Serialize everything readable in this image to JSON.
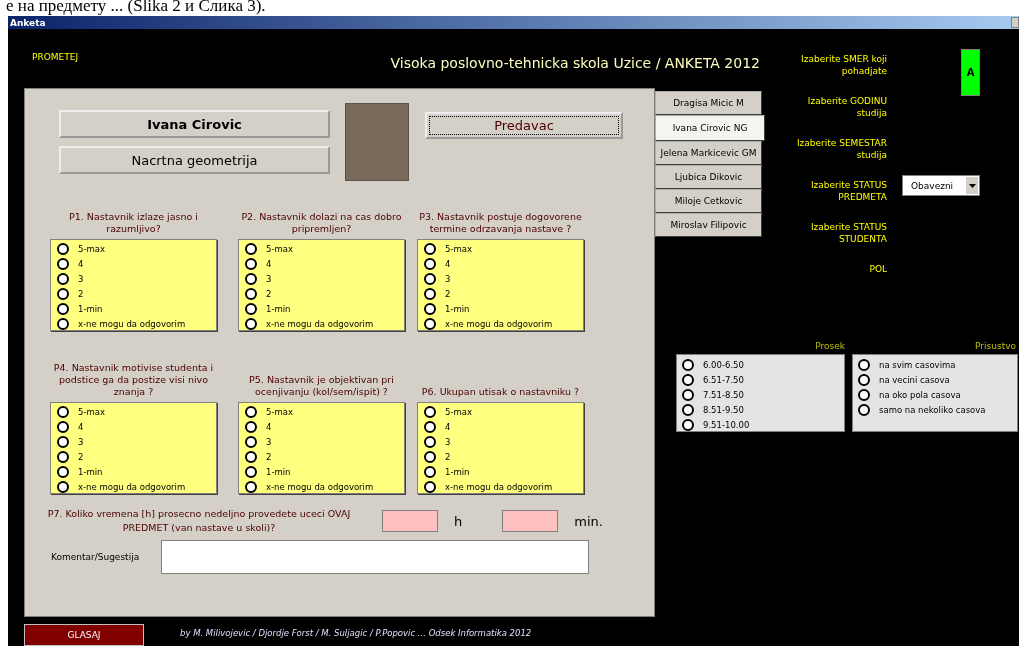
{
  "document_text": "е на предмету ... (Slika 2 и Слика 3).",
  "window": {
    "title": "Anketa"
  },
  "header": {
    "brand": "PROMETEJ",
    "title": "Visoka poslovno-tehnicka skola Uzice / ANKETA 2012"
  },
  "teacher": {
    "name": "Ivana Cirovic",
    "subject": "Nacrtna geometrija",
    "role_button": "Predavac"
  },
  "tabs": [
    {
      "label": "Dragisa Micic M",
      "selected": false
    },
    {
      "label": "Ivana Cirovic NG",
      "selected": true
    },
    {
      "label": "Jelena Markicevic GM",
      "selected": false
    },
    {
      "label": "Ljubica Dikovic",
      "selected": false
    },
    {
      "label": "Miloje Cetkovic",
      "selected": false
    },
    {
      "label": "Miroslav Filipovic",
      "selected": false
    }
  ],
  "questions": [
    {
      "text": "P1. Nastavnik izlaze jasno i razumljivo?",
      "options": [
        {
          "label": "5-max",
          "selected": false
        },
        {
          "label": "4",
          "selected": false
        },
        {
          "label": "3",
          "selected": false
        },
        {
          "label": "2",
          "selected": false
        },
        {
          "label": "1-min",
          "selected": false
        },
        {
          "label": "x-ne mogu da odgovorim",
          "selected": false
        }
      ]
    },
    {
      "text": "P2. Nastavnik dolazi na cas dobro pripremljen?",
      "options": [
        {
          "label": "5-max",
          "selected": false
        },
        {
          "label": "4",
          "selected": false
        },
        {
          "label": "3",
          "selected": false
        },
        {
          "label": "2",
          "selected": false
        },
        {
          "label": "1-min",
          "selected": false
        },
        {
          "label": "x-ne mogu da odgovorim",
          "selected": false
        }
      ]
    },
    {
      "text": "P3. Nastavnik postuje dogovorene termine odrzavanja nastave ?",
      "options": [
        {
          "label": "5-max",
          "selected": false
        },
        {
          "label": "4",
          "selected": false
        },
        {
          "label": "3",
          "selected": false
        },
        {
          "label": "2",
          "selected": false
        },
        {
          "label": "1-min",
          "selected": false
        },
        {
          "label": "x-ne mogu da odgovorim",
          "selected": false
        }
      ]
    },
    {
      "text": "P4. Nastavnik motivise studenta i podstice ga da postize visi nivo znanja ?",
      "options": [
        {
          "label": "5-max",
          "selected": false
        },
        {
          "label": "4",
          "selected": false
        },
        {
          "label": "3",
          "selected": false
        },
        {
          "label": "2",
          "selected": false
        },
        {
          "label": "1-min",
          "selected": false
        },
        {
          "label": "x-ne mogu da odgovorim",
          "selected": false
        }
      ]
    },
    {
      "text": "P5. Nastavnik je objektivan pri ocenjivanju (kol/sem/ispit) ?",
      "options": [
        {
          "label": "5-max",
          "selected": false
        },
        {
          "label": "4",
          "selected": false
        },
        {
          "label": "3",
          "selected": false
        },
        {
          "label": "2",
          "selected": false
        },
        {
          "label": "1-min",
          "selected": false
        },
        {
          "label": "x-ne mogu da odgovorim",
          "selected": false
        }
      ]
    },
    {
      "text": "P6. Ukupan utisak o nastavniku ?",
      "options": [
        {
          "label": "5-max",
          "selected": false
        },
        {
          "label": "4",
          "selected": false
        },
        {
          "label": "3",
          "selected": false
        },
        {
          "label": "2",
          "selected": false
        },
        {
          "label": "1-min",
          "selected": false
        },
        {
          "label": "x-ne mogu da odgovorim",
          "selected": false
        }
      ]
    }
  ],
  "time_question": {
    "text": "P7. Koliko vremena [h] prosecno nedeljno provedete uceci OVAJ PREDMET (van nastave u skoli)?",
    "hours_unit": "h",
    "minutes_unit": "min."
  },
  "comment": {
    "label": "Komentar/Sugestija"
  },
  "settings": [
    {
      "kind": "indicator",
      "label": "Izaberite SMER koji pohadjate",
      "value": "A"
    },
    {
      "kind": "plain",
      "label": "Izaberite GODINU studija"
    },
    {
      "kind": "plain",
      "label": "Izaberite SEMESTAR studija"
    },
    {
      "kind": "dropdown",
      "label": "Izaberite STATUS PREDMETA",
      "value": "Obavezni"
    },
    {
      "kind": "plain",
      "label": "Izaberite STATUS STUDENTA"
    },
    {
      "kind": "plain",
      "label": "POL"
    }
  ],
  "groups": [
    {
      "title": "Prosek",
      "options": [
        {
          "label": "6.00-6.50",
          "selected": false
        },
        {
          "label": "6.51-7.50",
          "selected": false
        },
        {
          "label": "7.51-8.50",
          "selected": false
        },
        {
          "label": "8.51-9.50",
          "selected": false
        },
        {
          "label": "9.51-10.00",
          "selected": false
        }
      ]
    },
    {
      "title": "Prisustvo",
      "options": [
        {
          "label": "na svim casovima",
          "selected": false
        },
        {
          "label": "na vecini casova",
          "selected": false
        },
        {
          "label": "na oko pola casova",
          "selected": false
        },
        {
          "label": "samo na nekoliko casova",
          "selected": false
        }
      ]
    }
  ],
  "footer": {
    "vote_button": "GLASAJ",
    "credits": "by M. Milivojevic / Djordje Forst / M. Suljagic / P.Popovic ... Odsek Informatika 2012"
  }
}
